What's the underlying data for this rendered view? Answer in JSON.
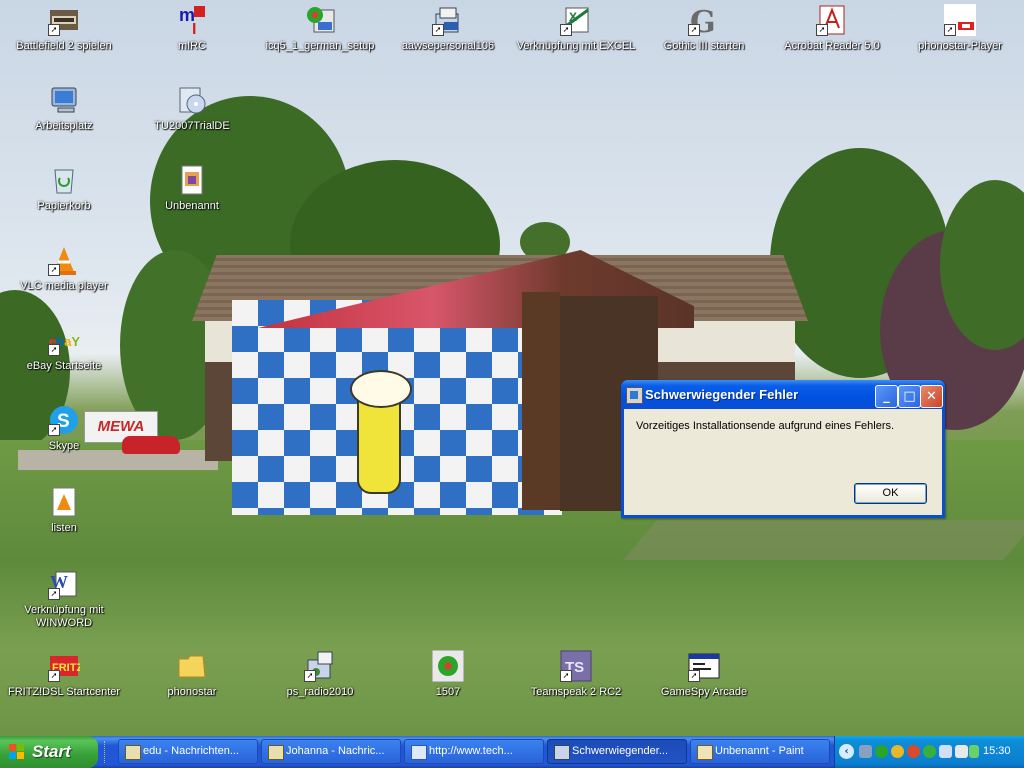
{
  "desktop": {
    "icons": [
      {
        "label": "Battlefield 2 spielen",
        "icon": "battlefield-icon"
      },
      {
        "label": "mIRC",
        "icon": "mirc-icon"
      },
      {
        "label": "icq5_1_german_setup",
        "icon": "icq-icon"
      },
      {
        "label": "aawsepersonal106",
        "icon": "installer-icon"
      },
      {
        "label": "Verknüpfung mit EXCEL",
        "icon": "excel-icon"
      },
      {
        "label": "Gothic III starten",
        "icon": "gothic-icon"
      },
      {
        "label": "Acrobat Reader 5.0",
        "icon": "acrobat-icon"
      },
      {
        "label": "phonostar-Player",
        "icon": "phonostar-player-icon"
      },
      {
        "label": "Arbeitsplatz",
        "icon": "my-computer-icon"
      },
      {
        "label": "TU2007TrialDE",
        "icon": "setup-cd-icon"
      },
      {
        "label": "Papierkorb",
        "icon": "recycle-bin-icon"
      },
      {
        "label": "Unbenannt",
        "icon": "image-file-icon"
      },
      {
        "label": "VLC media player",
        "icon": "vlc-icon"
      },
      {
        "label": "eBay Startseite",
        "icon": "ebay-icon"
      },
      {
        "label": "Skype",
        "icon": "skype-icon"
      },
      {
        "label": "listen",
        "icon": "vlc-playlist-icon"
      },
      {
        "label": "Verknüpfung mit\nWINWORD",
        "icon": "word-icon"
      },
      {
        "label": "FRITZ!DSL Startcenter",
        "icon": "fritz-icon"
      },
      {
        "label": "phonostar",
        "icon": "folder-icon"
      },
      {
        "label": "ps_radio2010",
        "icon": "radio-setup-icon"
      },
      {
        "label": "1507",
        "icon": "icq-flower-icon"
      },
      {
        "label": "Teamspeak 2 RC2",
        "icon": "teamspeak-icon"
      },
      {
        "label": "GameSpy Arcade",
        "icon": "gamespy-icon"
      }
    ]
  },
  "wallpaper": {
    "sign_text": "MEWA"
  },
  "dialog": {
    "title": "Schwerwiegender Fehler",
    "message": "Vorzeitiges Installationsende aufgrund eines Fehlers.",
    "ok_label": "OK",
    "minimize_glyph": "_",
    "maximize_glyph": "□",
    "close_glyph": "✕"
  },
  "taskbar": {
    "start_label": "Start",
    "tasks": [
      {
        "label": "edu - Nachrichten...",
        "icon": "chat-window-icon",
        "active": false
      },
      {
        "label": "Johanna - Nachric...",
        "icon": "chat-window-icon",
        "active": false
      },
      {
        "label": "http://www.tech...",
        "icon": "internet-explorer-icon",
        "active": false
      },
      {
        "label": "Schwerwiegender...",
        "icon": "installer-icon",
        "active": true
      },
      {
        "label": "Unbenannt - Paint",
        "icon": "paint-icon",
        "active": false
      }
    ],
    "tray_chevron": "‹",
    "clock": "15:30"
  },
  "colors": {
    "taskbar_blue": "#2157d7",
    "start_green": "#3aa33a",
    "tray_blue": "#0c7fd0",
    "dialog_title_blue": "#0051e0",
    "dialog_body": "#ece9d8"
  }
}
